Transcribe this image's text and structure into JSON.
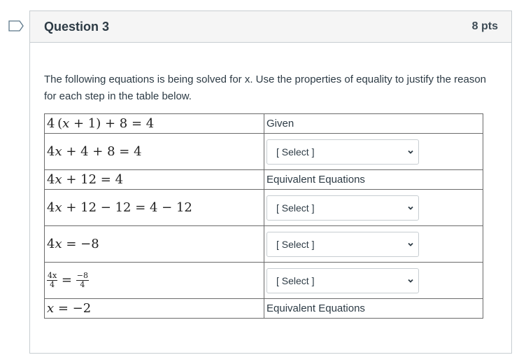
{
  "question": {
    "title": "Question 3",
    "points": "8 pts",
    "flag_icon": "bookmark-flag-icon",
    "prompt": "The following equations is being solved for x. Use the properties of equality to justify the reason for each step in the table below."
  },
  "table": {
    "rows": [
      {
        "equation": "4 (x + 1) + 8 = 4",
        "reason_type": "text",
        "reason": "Given"
      },
      {
        "equation": "4x + 4 + 8 = 4",
        "reason_type": "select",
        "reason": "[ Select ]"
      },
      {
        "equation": "4x + 12 = 4",
        "reason_type": "text",
        "reason": "Equivalent Equations"
      },
      {
        "equation": "4x + 12 − 12 = 4 − 12",
        "reason_type": "select",
        "reason": "[ Select ]"
      },
      {
        "equation": "4x = −8",
        "reason_type": "select",
        "reason": "[ Select ]"
      },
      {
        "equation": "4x/4 = −8/4",
        "reason_type": "select",
        "reason": "[ Select ]"
      },
      {
        "equation": "x = −2",
        "reason_type": "text",
        "reason": "Equivalent Equations"
      }
    ]
  },
  "math": {
    "r0": {
      "a": "4",
      "b": "(",
      "c": "x",
      "d": " + 1) + 8 = 4"
    },
    "r1": {
      "a": "4",
      "c": "x",
      "d": " + 4 + 8 = 4"
    },
    "r2": {
      "a": "4",
      "c": "x",
      "d": " + 12 = 4"
    },
    "r3": {
      "a": "4",
      "c": "x",
      "d": " + 12 − 12 = 4 − 12"
    },
    "r4": {
      "a": "4",
      "c": "x",
      "d": " = −8"
    },
    "r5": {
      "num1": "4x",
      "den1": "4",
      "eq": " = ",
      "num2": "−8",
      "den2": "4"
    },
    "r6": {
      "c": "x",
      "d": " = −2"
    }
  }
}
